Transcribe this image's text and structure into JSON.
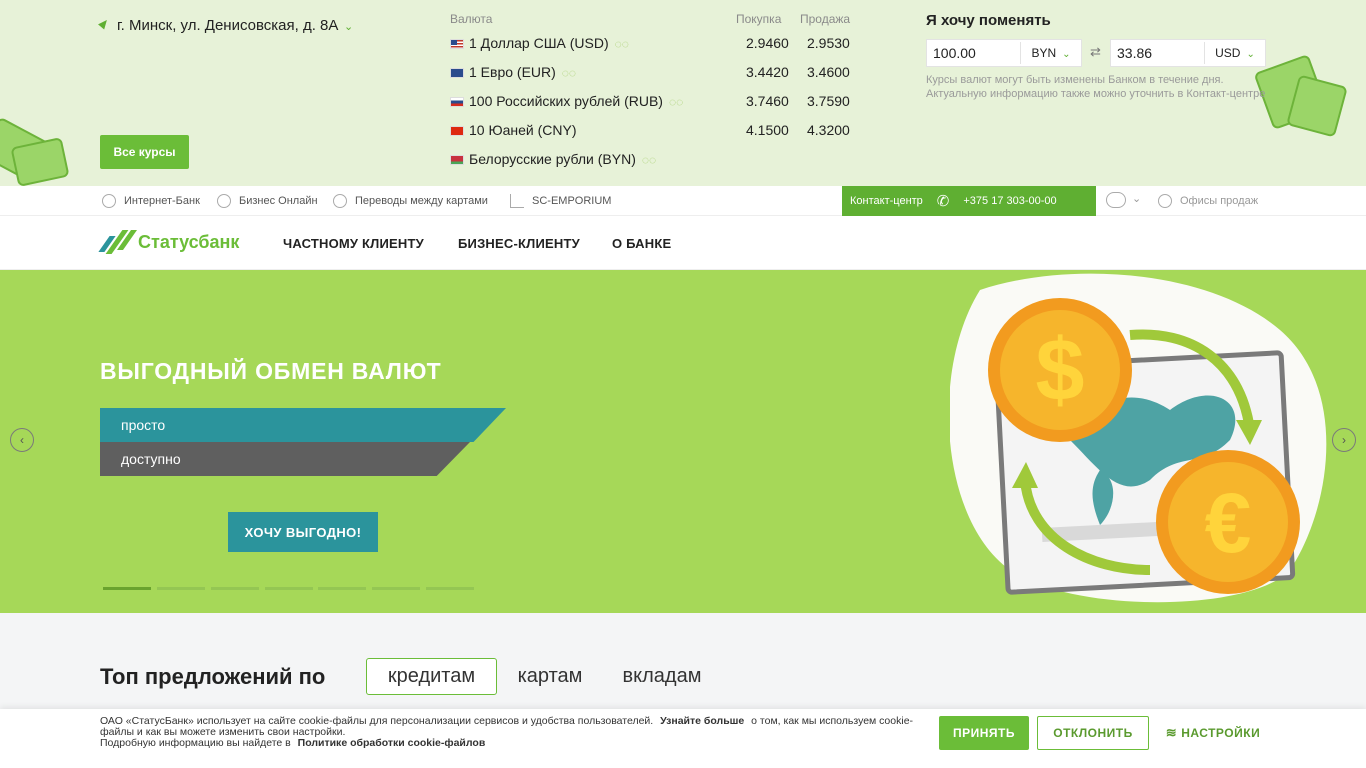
{
  "header": {
    "address": "г. Минск, ул. Денисовская, д. 8А",
    "all_rates": "Все курсы",
    "rates_col_currency": "Валюта",
    "rates_col_buy": "Покупка",
    "rates_col_sell": "Продажа",
    "rates": [
      {
        "name": "1 Доллар США (USD)",
        "buy": "2.9460",
        "sell": "2.9530"
      },
      {
        "name": "1 Евро (EUR)",
        "buy": "3.4420",
        "sell": "3.4600"
      },
      {
        "name": "100 Российских рублей (RUB)",
        "buy": "3.7460",
        "sell": "3.7590"
      },
      {
        "name": "10 Юаней (CNY)",
        "buy": "4.1500",
        "sell": "4.3200"
      },
      {
        "name": "Белорусские рубли (BYN)",
        "buy": "",
        "sell": ""
      }
    ],
    "exchange": {
      "title": "Я хочу поменять",
      "from_value": "100.00",
      "from_currency": "BYN",
      "to_value": "33.86",
      "to_currency": "USD",
      "note": "Курсы валют могут быть изменены Банком в течение дня. Актуальную информацию также можно уточнить в Контакт-центре"
    }
  },
  "util": {
    "links": [
      "Интернет-Банк",
      "Бизнес Онлайн",
      "Переводы между картами",
      "SC-EMPORIUM"
    ],
    "contact_label": "Контакт-центр",
    "phone": "+375 17 303-00-00",
    "offices": "Офисы продаж"
  },
  "nav": {
    "logo": "Статусбанк",
    "items": [
      "ЧАСТНОМУ КЛИЕНТУ",
      "БИЗНЕС-КЛИЕНТУ",
      "О БАНКЕ"
    ]
  },
  "hero": {
    "title": "ВЫГОДНЫЙ ОБМЕН ВАЛЮТ",
    "band1": "просто",
    "band2": "доступно",
    "cta": "ХОЧУ ВЫГОДНО!",
    "slides_total": 7,
    "active_slide": 1,
    "prev_icon": "chevron-left-icon",
    "next_icon": "chevron-right-icon"
  },
  "offers": {
    "title": "Топ предложений по",
    "tabs": [
      "кредитам",
      "картам",
      "вкладам"
    ],
    "active_tab": 0
  },
  "cookie": {
    "text1": "ОАО «СтатусБанк» использует на сайте cookie-файлы для персонализации сервисов и удобства пользователей.",
    "link1": "Узнайте больше",
    "text2": "о том, как мы используем cookie-файлы и как вы можете изменить свои настройки.",
    "text3": "Подробную информацию вы найдете в",
    "link2": "Политике обработки cookie-файлов",
    "accept": "ПРИНЯТЬ",
    "decline": "ОТКЛОНИТЬ",
    "settings": "НАСТРОЙКИ"
  },
  "colors": {
    "brand_green": "#6bbd38",
    "hero_green": "#a6d858",
    "teal": "#2b949c",
    "gray_band": "#5f5f5f",
    "top_bg": "#e7f2d8"
  }
}
